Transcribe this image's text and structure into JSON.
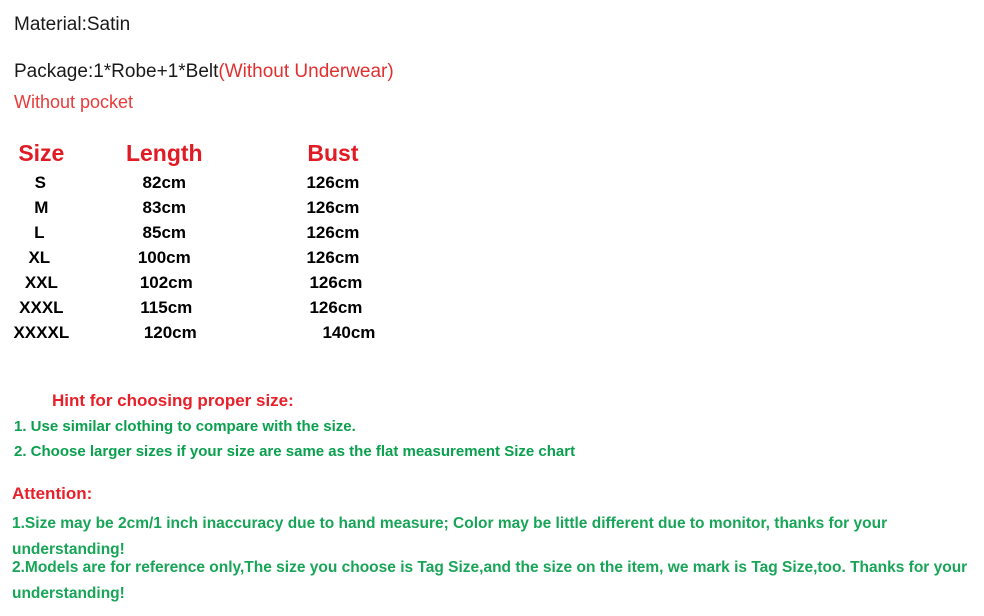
{
  "product_info": {
    "material_label": "Material:Satin",
    "package_label": "Package:1*Robe+1*Belt",
    "package_note": "(Without Underwear)",
    "without_pocket": "Without pocket"
  },
  "size_chart": {
    "headers": [
      "Size",
      "Length",
      "Bust"
    ],
    "rows": [
      {
        "size": "S",
        "length": "82cm",
        "bust": "126cm"
      },
      {
        "size": "M",
        "length": "83cm",
        "bust": "126cm"
      },
      {
        "size": "L",
        "length": "85cm",
        "bust": "126cm"
      },
      {
        "size": "XL",
        "length": "100cm",
        "bust": "126cm"
      },
      {
        "size": "XXL",
        "length": "102cm",
        "bust": "126cm"
      },
      {
        "size": "XXXL",
        "length": "115cm",
        "bust": "126cm"
      },
      {
        "size": "XXXXL",
        "length": "120cm",
        "bust": "140cm"
      }
    ]
  },
  "hint": {
    "title": "Hint for choosing proper size:",
    "line1": "1. Use similar clothing to compare with the size.",
    "line2": "2. Choose larger sizes if your size are same as the flat measurement Size chart"
  },
  "attention": {
    "title": "Attention:",
    "line1": "1.Size may be 2cm/1 inch inaccuracy due to hand measure; Color may be little different   due to monitor, thanks for your understanding!",
    "line2": "2.Models are for reference only,The size you choose is Tag Size,and the size on the item,  we mark is Tag Size,too. Thanks for your understanding!"
  },
  "colors": {
    "red": "#e8202a",
    "red_note": "#e03030",
    "green": "#0aa04e",
    "green_attention": "#18a558",
    "black": "#1a1a1a",
    "background": "#ffffff"
  },
  "chart_data": {
    "type": "table",
    "title": "Size chart",
    "columns": [
      "Size",
      "Length",
      "Bust"
    ],
    "units": "cm",
    "categories": [
      "S",
      "M",
      "L",
      "XL",
      "XXL",
      "XXXL",
      "XXXXL"
    ],
    "series": [
      {
        "name": "Length",
        "values": [
          82,
          83,
          85,
          100,
          102,
          115,
          120
        ]
      },
      {
        "name": "Bust",
        "values": [
          126,
          126,
          126,
          126,
          126,
          126,
          140
        ]
      }
    ]
  }
}
